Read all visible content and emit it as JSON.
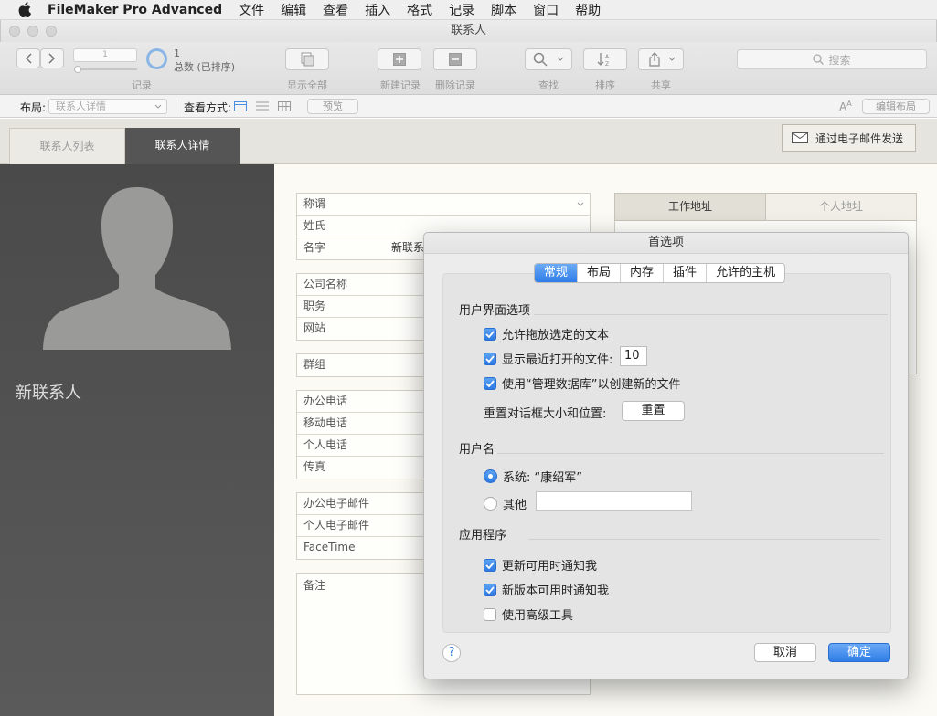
{
  "menubar": {
    "app": "FileMaker Pro Advanced",
    "items": [
      "文件",
      "编辑",
      "查看",
      "插入",
      "格式",
      "记录",
      "脚本",
      "窗口",
      "帮助"
    ]
  },
  "window": {
    "title": "联系人"
  },
  "toolbar": {
    "record_input": "1",
    "record_count": "1",
    "total_label": "总数 (已排序)",
    "records_label": "记录",
    "show_all": "显示全部",
    "new_record": "新建记录",
    "delete_record": "删除记录",
    "find": "查找",
    "sort": "排序",
    "share": "共享",
    "search_placeholder": "搜索"
  },
  "layoutbar": {
    "layout_label": "布局:",
    "layout_value": "联系人详情",
    "view_as_label": "查看方式:",
    "preview": "预览",
    "edit_layout": "编辑布局"
  },
  "tabs": {
    "list": "联系人列表",
    "detail": "联系人详情"
  },
  "email_button": "通过电子邮件发送",
  "left_panel": {
    "name": "新联系人"
  },
  "address_tabs": {
    "work": "工作地址",
    "home": "个人地址"
  },
  "fields": {
    "salutation": "称谓",
    "last_name": "姓氏",
    "first_name": "名字",
    "first_name_value": "新联系",
    "company": "公司名称",
    "title": "职务",
    "website": "网站",
    "group": "群组",
    "work_phone": "办公电话",
    "mobile": "移动电话",
    "home_phone": "个人电话",
    "fax": "传真",
    "work_email": "办公电子邮件",
    "home_email": "个人电子邮件",
    "facetime": "FaceTime",
    "notes": "备注"
  },
  "dialog": {
    "title": "首选项",
    "tabs": [
      "常规",
      "布局",
      "内存",
      "插件",
      "允许的主机"
    ],
    "ui_section": "用户界面选项",
    "allow_drag": "允许拖放选定的文本",
    "show_recent": "显示最近打开的文件:",
    "recent_count": "10",
    "use_manage_db": "使用“管理数据库”以创建新的文件",
    "reset_label": "重置对话框大小和位置:",
    "reset_button": "重置",
    "username_section": "用户名",
    "system_user": "系统: “康绍军”",
    "other": "其他",
    "other_value": "",
    "app_section": "应用程序",
    "notify_updates": "更新可用时通知我",
    "notify_new_version": "新版本可用时通知我",
    "advanced_tools": "使用高级工具",
    "help": "?",
    "cancel": "取消",
    "ok": "确定"
  },
  "colors": {
    "accent": "#2f7de8",
    "left_panel": "#4a4a4a",
    "content_bg": "#fbfaf4"
  }
}
